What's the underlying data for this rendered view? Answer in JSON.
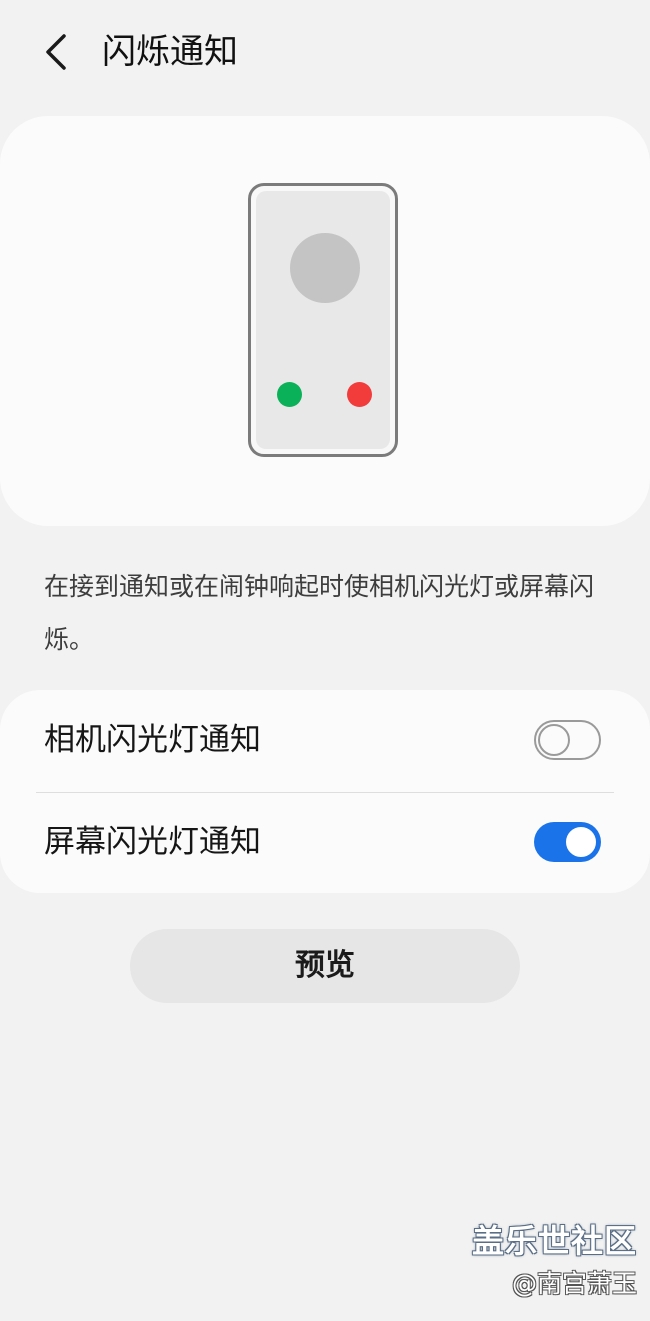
{
  "header": {
    "title": "闪烁通知",
    "back_icon": "chevron-left-icon"
  },
  "illustration": {
    "accept_color": "#0bb159",
    "decline_color": "#f23b3b",
    "avatar_color": "#c4c4c4"
  },
  "description": "在接到通知或在闹钟响起时使相机闪光灯或屏幕闪烁。",
  "settings": {
    "items": [
      {
        "label": "相机闪光灯通知",
        "enabled": false
      },
      {
        "label": "屏幕闪光灯通知",
        "enabled": true
      }
    ],
    "accent_color": "#1a73e8"
  },
  "preview_button": {
    "label": "预览"
  },
  "watermark": {
    "brand": "盖乐世社区",
    "author": "@南宫萧玉"
  }
}
